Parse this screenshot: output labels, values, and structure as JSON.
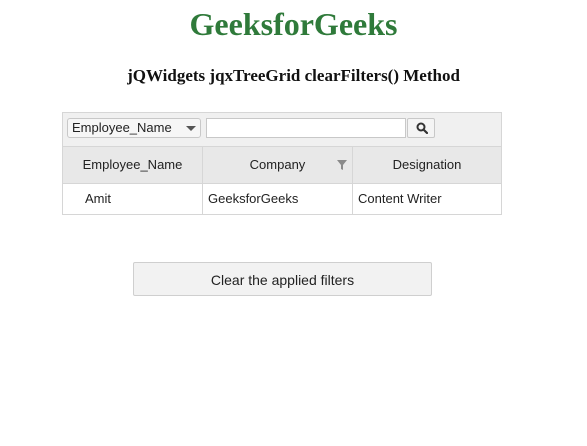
{
  "header": {
    "title": "GeeksforGeeks",
    "subtitle": "jQWidgets jqxTreeGrid clearFilters() Method"
  },
  "filter_bar": {
    "column_select_value": "Employee_Name",
    "search_value": "",
    "search_icon": "magnifier-icon"
  },
  "grid": {
    "columns": [
      "Employee_Name",
      "Company",
      "Designation"
    ],
    "filtered_column_icon": "filter-icon",
    "rows": [
      [
        "Amit",
        "GeeksforGeeks",
        "Content Writer"
      ]
    ]
  },
  "clear_button": {
    "label": "Clear the applied filters"
  },
  "colors": {
    "title": "#2f7a3a"
  }
}
